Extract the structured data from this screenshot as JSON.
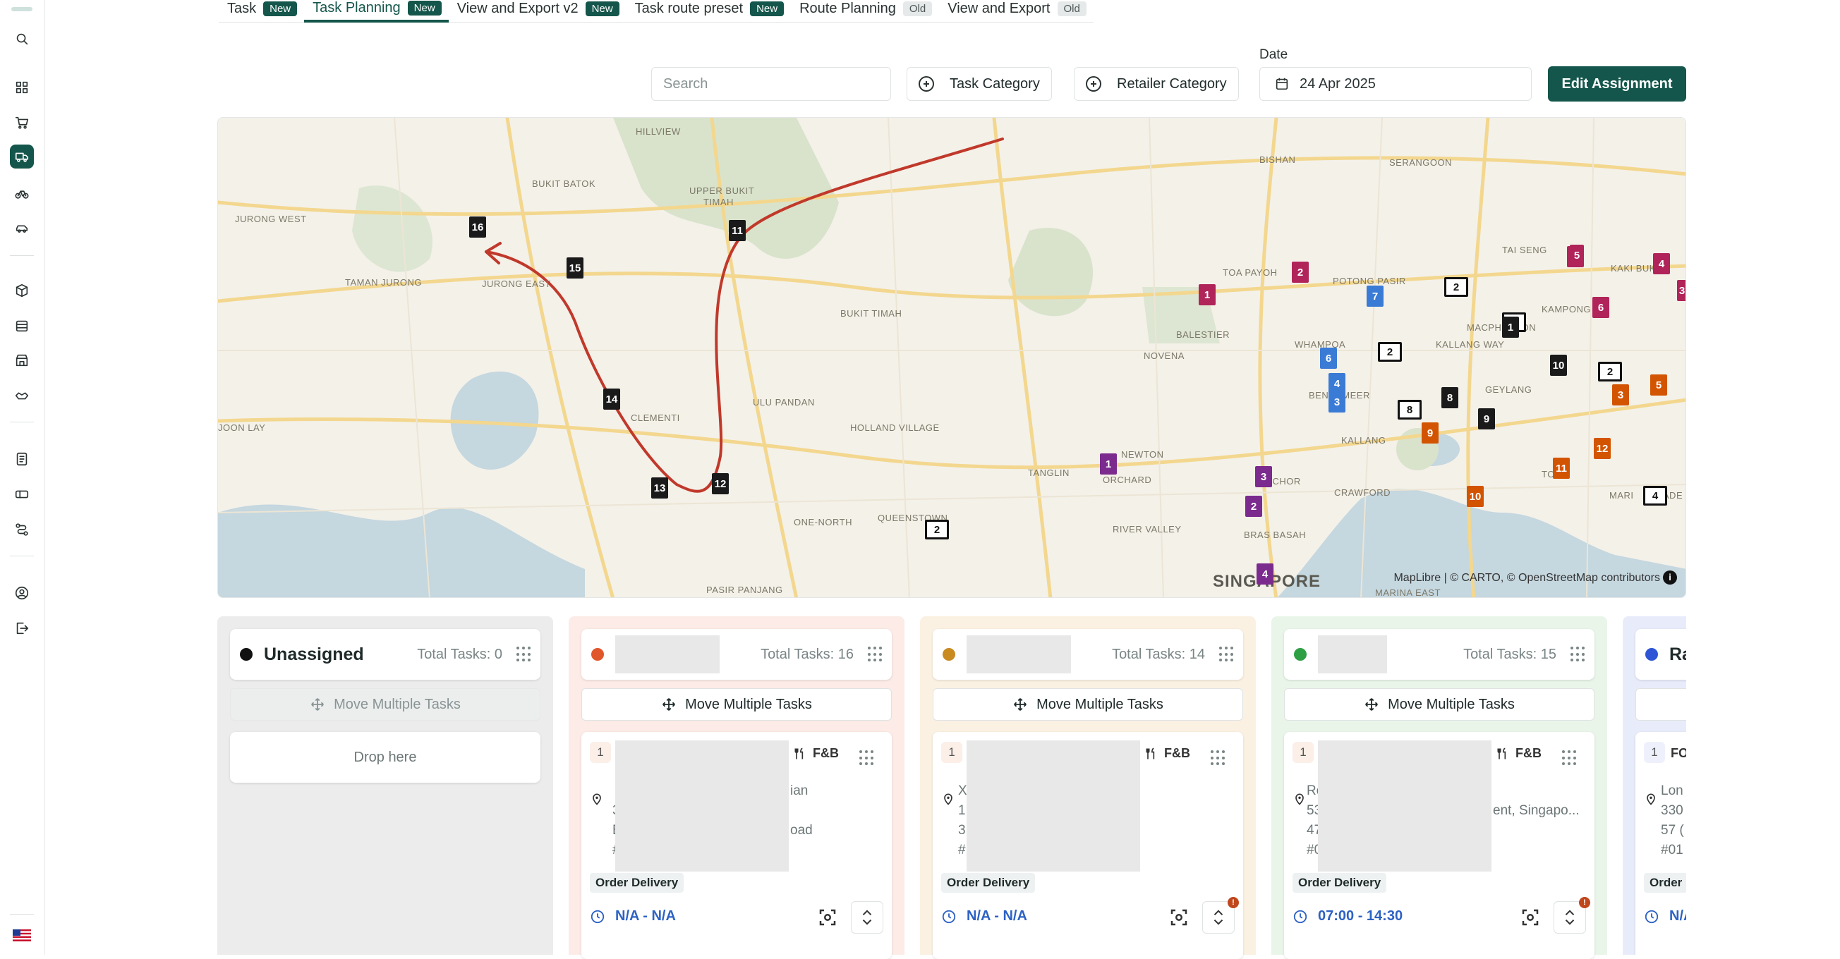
{
  "tabs": [
    {
      "label": "Task",
      "badge": "New"
    },
    {
      "label": "Task Planning",
      "badge": "New"
    },
    {
      "label": "View and Export v2",
      "badge": "New"
    },
    {
      "label": "Task route preset",
      "badge": "New"
    },
    {
      "label": "Route Planning",
      "badge": "Old"
    },
    {
      "label": "View and Export",
      "badge": "Old"
    }
  ],
  "toolbar": {
    "search_placeholder": "Search",
    "task_category": "Task Category",
    "retailer_category": "Retailer Category",
    "date_label": "Date",
    "date_value": "24 Apr 2025",
    "edit_assignment": "Edit Assignment"
  },
  "map": {
    "places": [
      "HILLVIEW",
      "BUKIT BATOK",
      "UPPER BUKIT",
      "TIMAH",
      "JURONG WEST",
      "TAMAN JURONG",
      "JURONG EAST",
      "BUKIT TIMAH",
      "CLEMENTI",
      "ULU PANDAN",
      "HOLLAND VILLAGE",
      "JOON LAY",
      "ONE-NORTH",
      "QUEENSTOWN",
      "PASIR PANJANG",
      "TANGLIN",
      "ORCHARD",
      "NEWTON",
      "RIVER VALLEY",
      "BRAS BASAH",
      "CRAWFORD",
      "BISHAN",
      "SERANGOON",
      "TOA PAYOH",
      "POTONG PASIR",
      "BALESTIER",
      "WHAMPOA",
      "NOVENA",
      "KALLANG WAY",
      "KALLANG",
      "GEYLANG",
      "KAMPONG",
      "KAKI BUKIT",
      "TAI SENG",
      "MACPHERSON",
      "MARINA EAST",
      "BENDEMEER",
      "ROCHOR",
      "TONG",
      "MARI",
      "RADE"
    ],
    "city": "SINGAPORE",
    "attribution": "MapLibre | © CARTO, © OpenStreetMap contributors",
    "route_markers": [
      "16",
      "15",
      "11",
      "14",
      "13",
      "12"
    ],
    "markers": [
      "1",
      "2",
      "2",
      "7",
      "2",
      "6",
      "2",
      "3",
      "4",
      "1",
      "2",
      "8",
      "9",
      "10",
      "2",
      "3",
      "5",
      "6",
      "8",
      "11",
      "12",
      "9",
      "10",
      "4",
      "4",
      "1",
      "3",
      "2",
      "2",
      "5",
      "4",
      "3"
    ]
  },
  "columns": [
    {
      "title": "Unassigned",
      "total": "Total Tasks: 0",
      "move": "Move Multiple Tasks",
      "drop": "Drop here",
      "color": "#111111"
    },
    {
      "total": "Total Tasks: 16",
      "move": "Move Multiple Tasks",
      "color": "#e0572b",
      "card": {
        "num": "1",
        "tag": "F&B",
        "addr_lines": [
          "",
          "3",
          "Bl",
          "#0"
        ],
        "addr_right": [
          "ian",
          "oad"
        ],
        "addr_first": "",
        "order": "Order Delivery",
        "time": "N/A - N/A",
        "alert": false
      }
    },
    {
      "total": "Total Tasks: 14",
      "move": "Move Multiple Tasks",
      "color": "#c98a20",
      "card": {
        "num": "1",
        "tag": "F&B",
        "addr_lines": [
          "X",
          "1",
          "3",
          "#"
        ],
        "addr_right": [],
        "order": "Order Delivery",
        "time": "N/A - N/A",
        "alert": true
      }
    },
    {
      "total": "Total Tasks: 15",
      "move": "Move Multiple Tasks",
      "color": "#2ea043",
      "card": {
        "num": "1",
        "tag": "F&B",
        "addr_lines": [
          "Ro",
          "53",
          "47",
          "#0"
        ],
        "addr_right": [
          "ent, Singapo..."
        ],
        "order": "Order Delivery",
        "time": "07:00 - 14:30",
        "alert": true
      }
    },
    {
      "title": "Ra",
      "color": "#2d55d6",
      "card": {
        "num": "1",
        "tag": "FO",
        "addr_lines": [
          "Lon",
          "330",
          "57 (",
          "#01"
        ],
        "order": "Order",
        "time": "N/A"
      }
    }
  ]
}
